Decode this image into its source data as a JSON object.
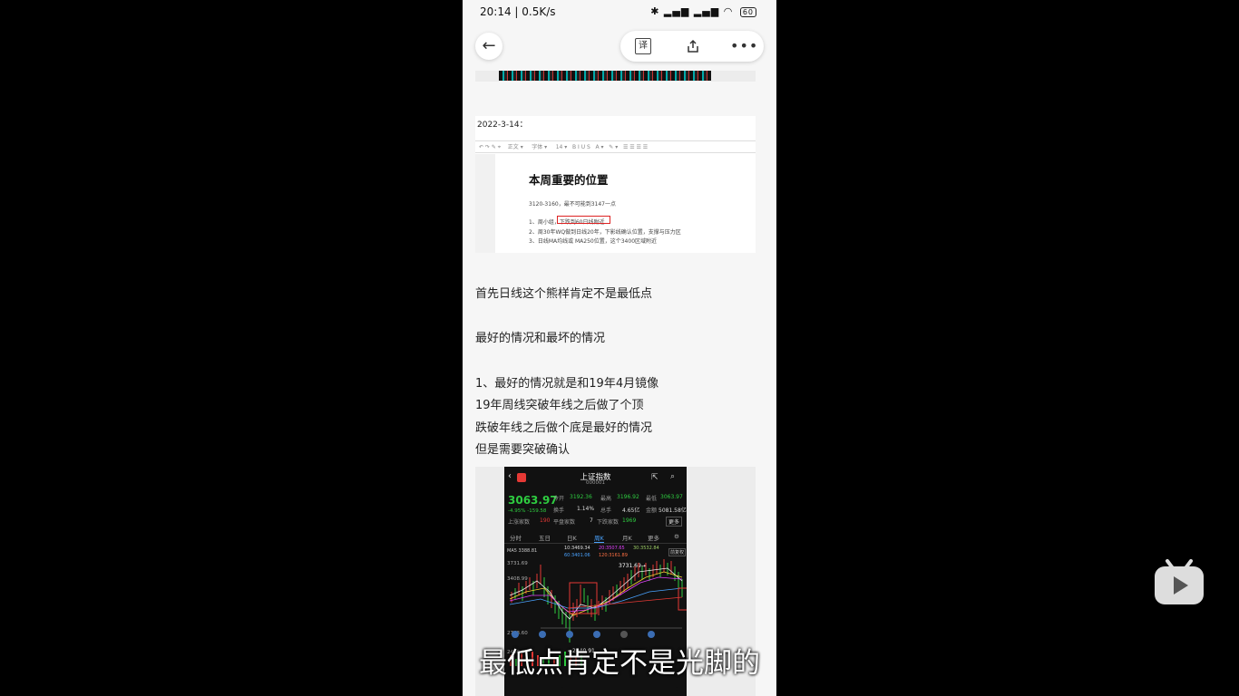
{
  "status_bar": {
    "time": "20:14 | 0.5K/s",
    "battery": "60"
  },
  "doc_image": {
    "date": "2022-3-14：",
    "title": "本周重要的位置",
    "line1": "3120-3160，最不可能到3147一点",
    "item1": "1、周小组，下跌到60日线附近",
    "item2": "2、周30年WQ做到日线20年，下影线确认位置，支撑与压力区",
    "item3": "3、日线MA均线或 MA250位置，这个3400区域附近"
  },
  "paragraphs": [
    "首先日线这个熊样肯定不是最低点",
    "最好的情况和最坏的情况",
    "1、最好的情况就是和19年4月镜像",
    "19年周线突破年线之后做了个顶",
    "跌破年线之后做个底是最好的情况",
    "但是需要突破确认"
  ],
  "stock": {
    "title": "上证指数",
    "code": "000001",
    "price": "3063.97",
    "change": "-4.95% -159.58",
    "open_label": "今开",
    "open": "3192.36",
    "high_label": "最高",
    "high": "3196.92",
    "low_label": "最低",
    "low": "3063.97",
    "turnover_label": "换手",
    "turnover": "1.14%",
    "hands_label": "总手",
    "hands": "4.65亿",
    "amount_label": "金额",
    "amount": "5081.58亿",
    "rise_label": "上涨家数",
    "rise": "190",
    "flat_label": "平盘家数",
    "flat": "7",
    "fall_label": "下跌家数",
    "fall": "1969",
    "more_btn": "更多",
    "tabs": [
      "分时",
      "五日",
      "日K",
      "周K",
      "月K",
      "更多"
    ],
    "ma_line": "MA5 3388.81",
    "ma10": "10:3469.34",
    "ma20": "20:3507.65",
    "ma30": "30:3532.84",
    "ma60": "60:3401.06",
    "ma120": "120:3161.89",
    "y_labels": [
      "3731.69",
      "3408.99",
      "2763.60",
      "2440.91"
    ],
    "peak_label": "3731.69→",
    "low_mark": "←2440.91",
    "adjust": "前复权"
  },
  "subtitle": "最低点肯定不是光脚的",
  "colors": {
    "up": "#e53935",
    "down": "#2ecc40",
    "accent": "#4aa3ff"
  }
}
